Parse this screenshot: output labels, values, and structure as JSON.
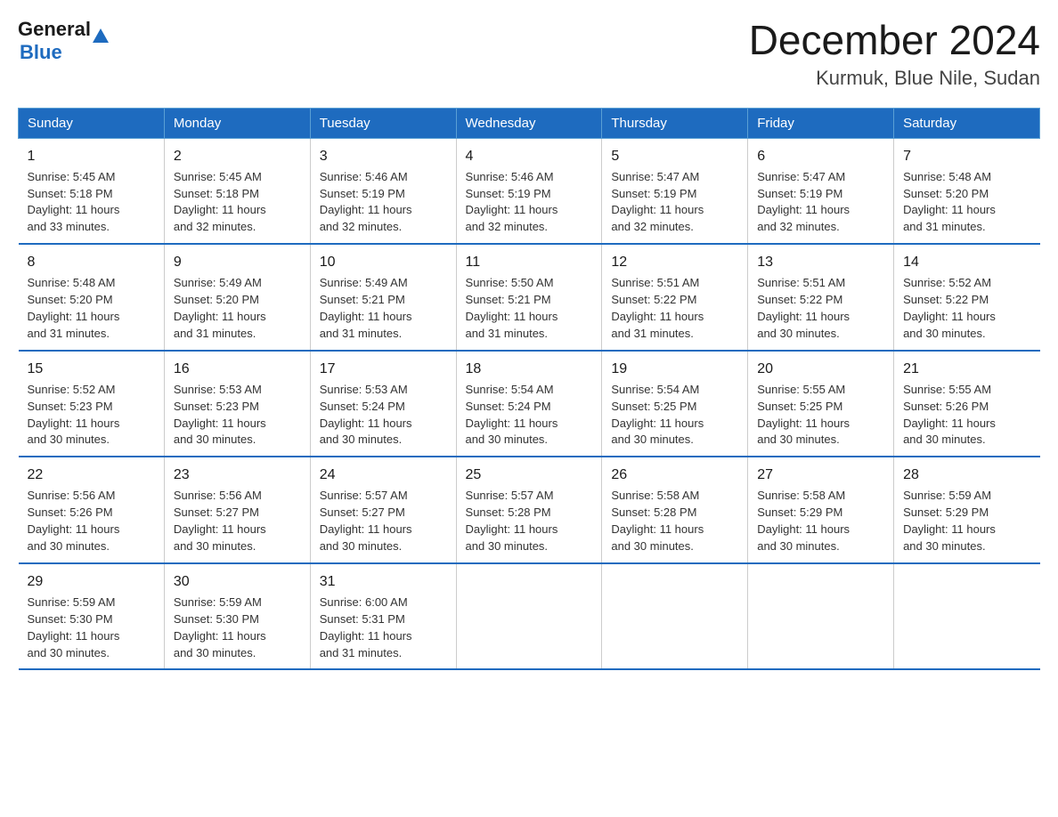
{
  "logo": {
    "general": "General",
    "blue": "Blue"
  },
  "title": "December 2024",
  "subtitle": "Kurmuk, Blue Nile, Sudan",
  "headers": [
    "Sunday",
    "Monday",
    "Tuesday",
    "Wednesday",
    "Thursday",
    "Friday",
    "Saturday"
  ],
  "weeks": [
    [
      {
        "day": "1",
        "sunrise": "5:45 AM",
        "sunset": "5:18 PM",
        "daylight": "11 hours and 33 minutes."
      },
      {
        "day": "2",
        "sunrise": "5:45 AM",
        "sunset": "5:18 PM",
        "daylight": "11 hours and 32 minutes."
      },
      {
        "day": "3",
        "sunrise": "5:46 AM",
        "sunset": "5:19 PM",
        "daylight": "11 hours and 32 minutes."
      },
      {
        "day": "4",
        "sunrise": "5:46 AM",
        "sunset": "5:19 PM",
        "daylight": "11 hours and 32 minutes."
      },
      {
        "day": "5",
        "sunrise": "5:47 AM",
        "sunset": "5:19 PM",
        "daylight": "11 hours and 32 minutes."
      },
      {
        "day": "6",
        "sunrise": "5:47 AM",
        "sunset": "5:19 PM",
        "daylight": "11 hours and 32 minutes."
      },
      {
        "day": "7",
        "sunrise": "5:48 AM",
        "sunset": "5:20 PM",
        "daylight": "11 hours and 31 minutes."
      }
    ],
    [
      {
        "day": "8",
        "sunrise": "5:48 AM",
        "sunset": "5:20 PM",
        "daylight": "11 hours and 31 minutes."
      },
      {
        "day": "9",
        "sunrise": "5:49 AM",
        "sunset": "5:20 PM",
        "daylight": "11 hours and 31 minutes."
      },
      {
        "day": "10",
        "sunrise": "5:49 AM",
        "sunset": "5:21 PM",
        "daylight": "11 hours and 31 minutes."
      },
      {
        "day": "11",
        "sunrise": "5:50 AM",
        "sunset": "5:21 PM",
        "daylight": "11 hours and 31 minutes."
      },
      {
        "day": "12",
        "sunrise": "5:51 AM",
        "sunset": "5:22 PM",
        "daylight": "11 hours and 31 minutes."
      },
      {
        "day": "13",
        "sunrise": "5:51 AM",
        "sunset": "5:22 PM",
        "daylight": "11 hours and 30 minutes."
      },
      {
        "day": "14",
        "sunrise": "5:52 AM",
        "sunset": "5:22 PM",
        "daylight": "11 hours and 30 minutes."
      }
    ],
    [
      {
        "day": "15",
        "sunrise": "5:52 AM",
        "sunset": "5:23 PM",
        "daylight": "11 hours and 30 minutes."
      },
      {
        "day": "16",
        "sunrise": "5:53 AM",
        "sunset": "5:23 PM",
        "daylight": "11 hours and 30 minutes."
      },
      {
        "day": "17",
        "sunrise": "5:53 AM",
        "sunset": "5:24 PM",
        "daylight": "11 hours and 30 minutes."
      },
      {
        "day": "18",
        "sunrise": "5:54 AM",
        "sunset": "5:24 PM",
        "daylight": "11 hours and 30 minutes."
      },
      {
        "day": "19",
        "sunrise": "5:54 AM",
        "sunset": "5:25 PM",
        "daylight": "11 hours and 30 minutes."
      },
      {
        "day": "20",
        "sunrise": "5:55 AM",
        "sunset": "5:25 PM",
        "daylight": "11 hours and 30 minutes."
      },
      {
        "day": "21",
        "sunrise": "5:55 AM",
        "sunset": "5:26 PM",
        "daylight": "11 hours and 30 minutes."
      }
    ],
    [
      {
        "day": "22",
        "sunrise": "5:56 AM",
        "sunset": "5:26 PM",
        "daylight": "11 hours and 30 minutes."
      },
      {
        "day": "23",
        "sunrise": "5:56 AM",
        "sunset": "5:27 PM",
        "daylight": "11 hours and 30 minutes."
      },
      {
        "day": "24",
        "sunrise": "5:57 AM",
        "sunset": "5:27 PM",
        "daylight": "11 hours and 30 minutes."
      },
      {
        "day": "25",
        "sunrise": "5:57 AM",
        "sunset": "5:28 PM",
        "daylight": "11 hours and 30 minutes."
      },
      {
        "day": "26",
        "sunrise": "5:58 AM",
        "sunset": "5:28 PM",
        "daylight": "11 hours and 30 minutes."
      },
      {
        "day": "27",
        "sunrise": "5:58 AM",
        "sunset": "5:29 PM",
        "daylight": "11 hours and 30 minutes."
      },
      {
        "day": "28",
        "sunrise": "5:59 AM",
        "sunset": "5:29 PM",
        "daylight": "11 hours and 30 minutes."
      }
    ],
    [
      {
        "day": "29",
        "sunrise": "5:59 AM",
        "sunset": "5:30 PM",
        "daylight": "11 hours and 30 minutes."
      },
      {
        "day": "30",
        "sunrise": "5:59 AM",
        "sunset": "5:30 PM",
        "daylight": "11 hours and 30 minutes."
      },
      {
        "day": "31",
        "sunrise": "6:00 AM",
        "sunset": "5:31 PM",
        "daylight": "11 hours and 31 minutes."
      },
      null,
      null,
      null,
      null
    ]
  ],
  "labels": {
    "sunrise": "Sunrise:",
    "sunset": "Sunset:",
    "daylight": "Daylight:"
  }
}
